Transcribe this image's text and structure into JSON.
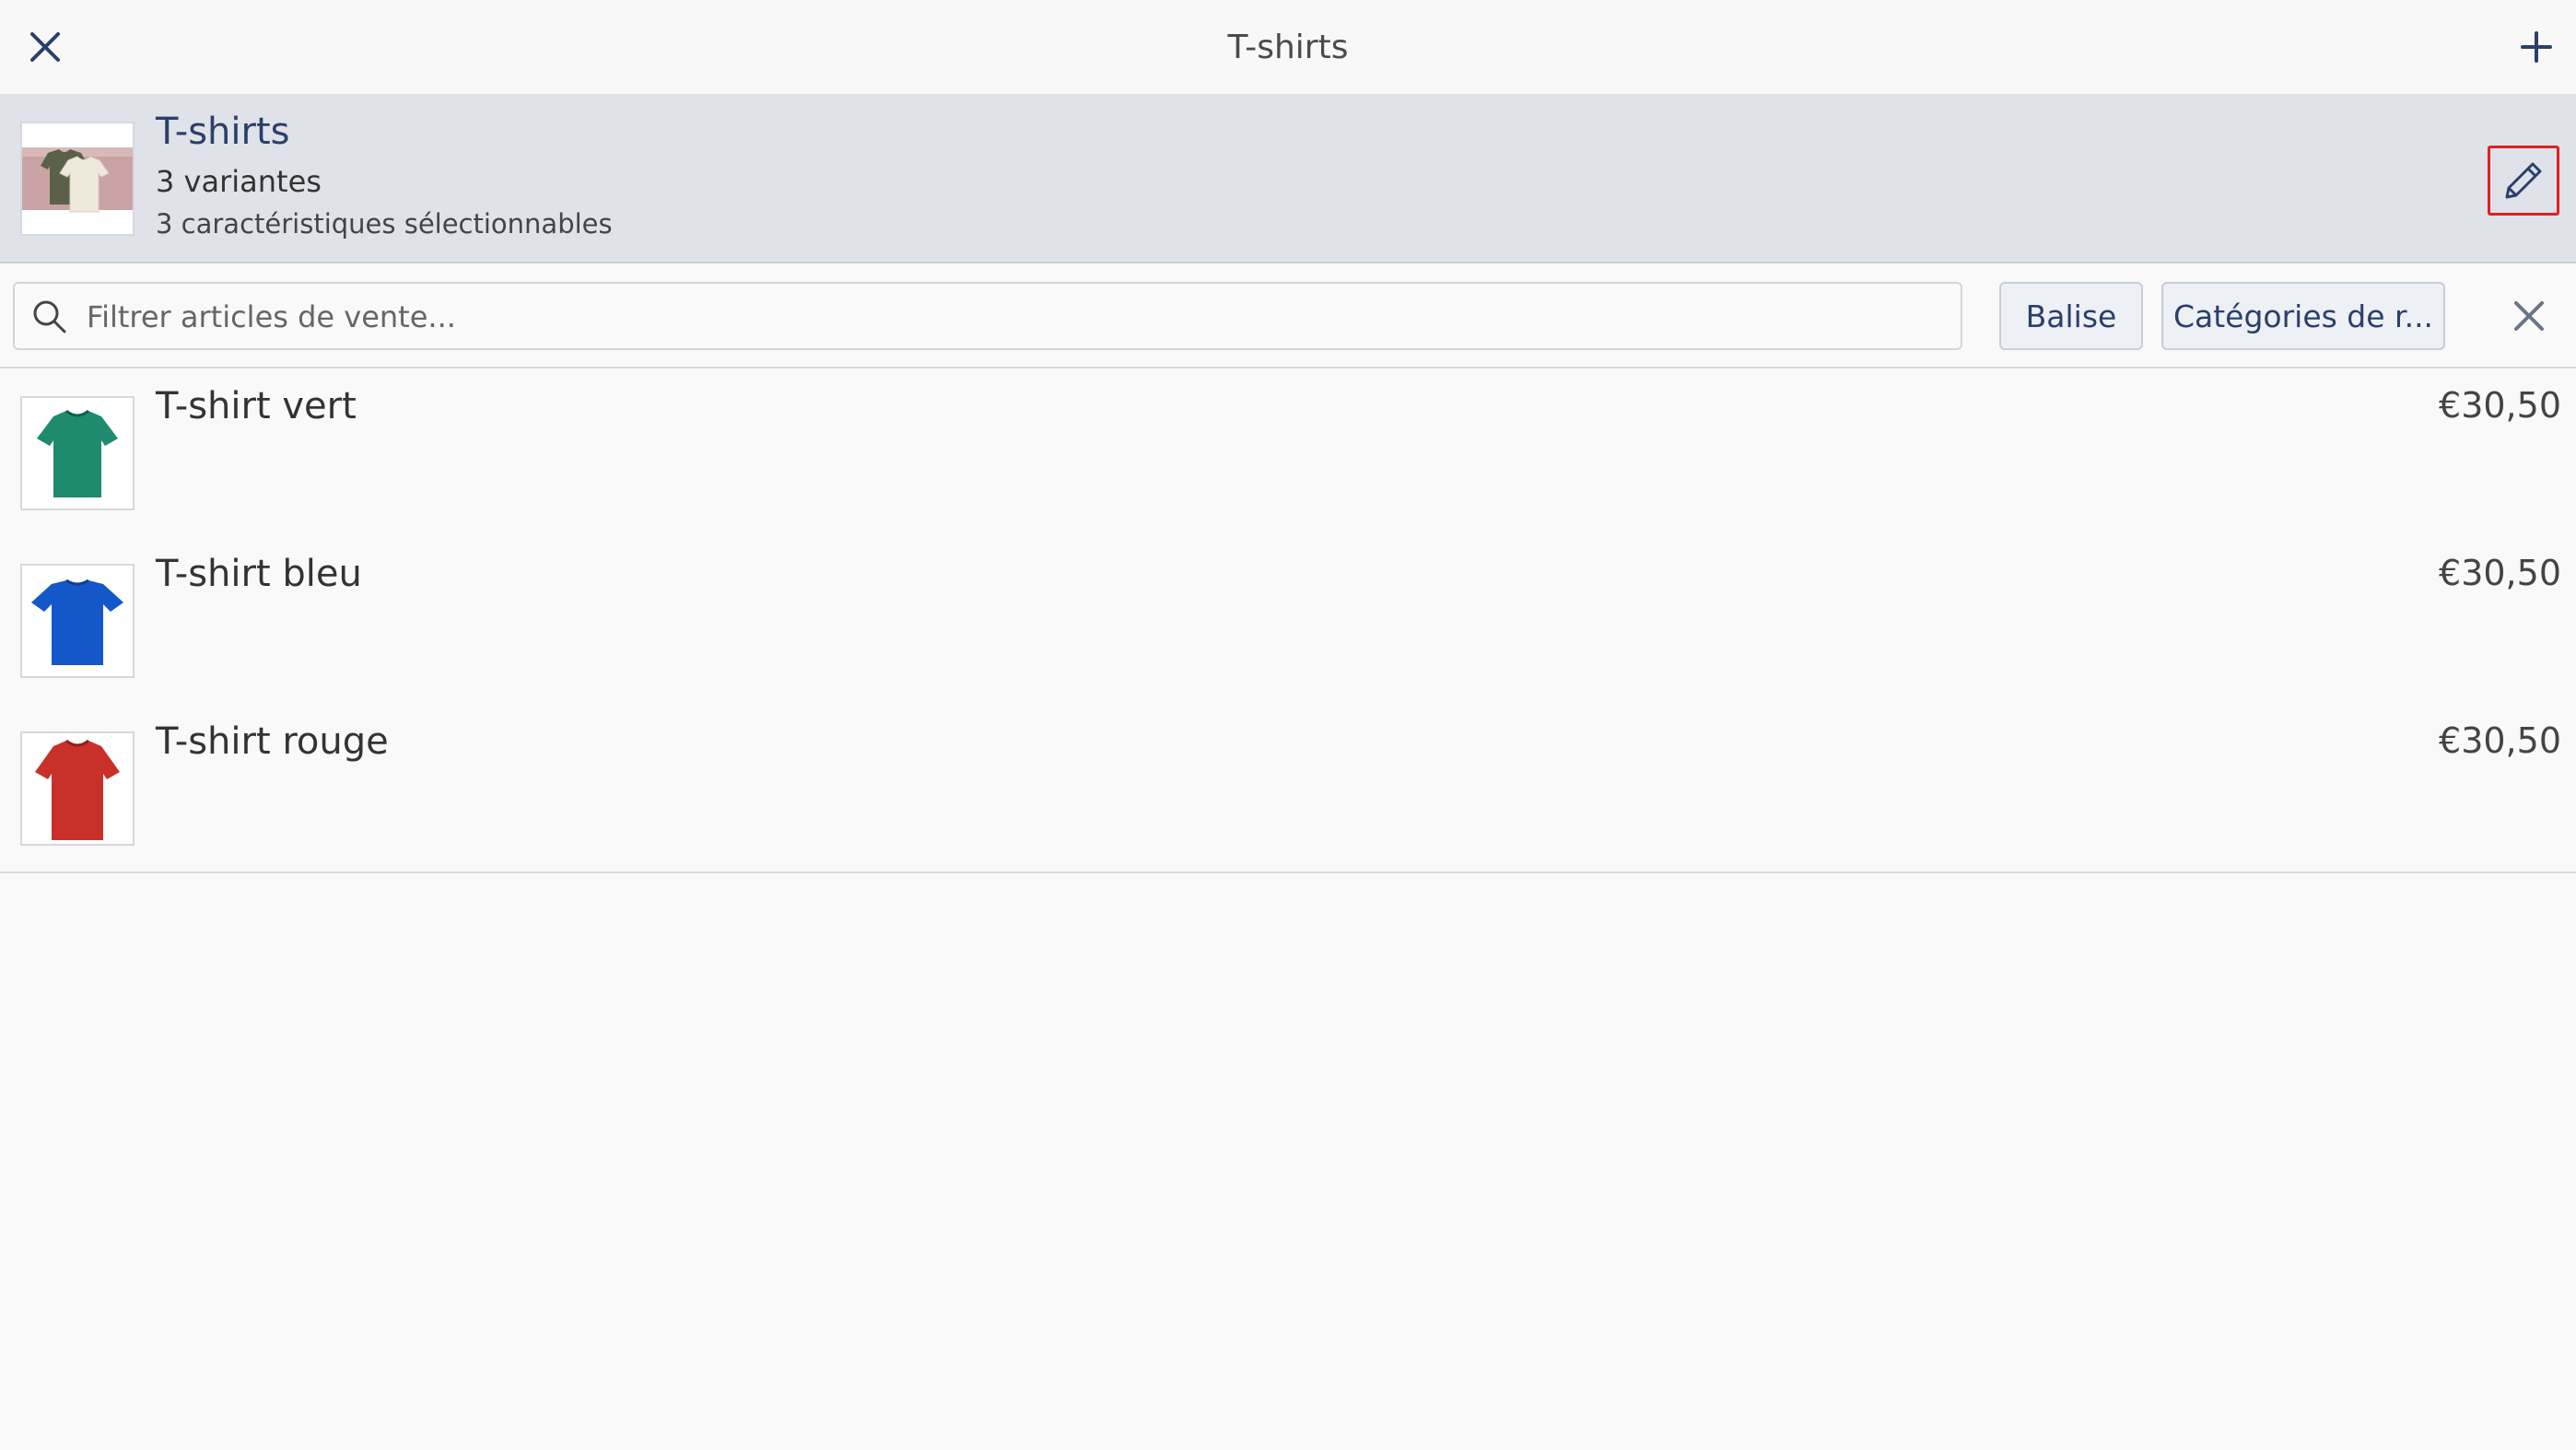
{
  "topbar": {
    "title": "T-shirts",
    "close_icon": "close-icon",
    "add_icon": "plus-icon"
  },
  "header": {
    "title": "T-shirts",
    "variants": "3 variantes",
    "features": "3 caractéristiques sélectionnables",
    "edit_icon": "pencil-icon"
  },
  "filters": {
    "search_placeholder": "Filtrer articles de vente...",
    "search_value": "",
    "tag_label": "Balise",
    "category_label": "Catégories de r...",
    "clear_icon": "close-icon"
  },
  "items": [
    {
      "name": "T-shirt vert",
      "price": "€30,50",
      "color": "#1e8a6e"
    },
    {
      "name": "T-shirt bleu",
      "price": "€30,50",
      "color": "#1457c8"
    },
    {
      "name": "T-shirt rouge",
      "price": "€30,50",
      "color": "#c9302a"
    }
  ],
  "colors": {
    "accent": "#2b3f6b",
    "header_bg": "#dfe3e9",
    "highlight": "#e02020"
  }
}
